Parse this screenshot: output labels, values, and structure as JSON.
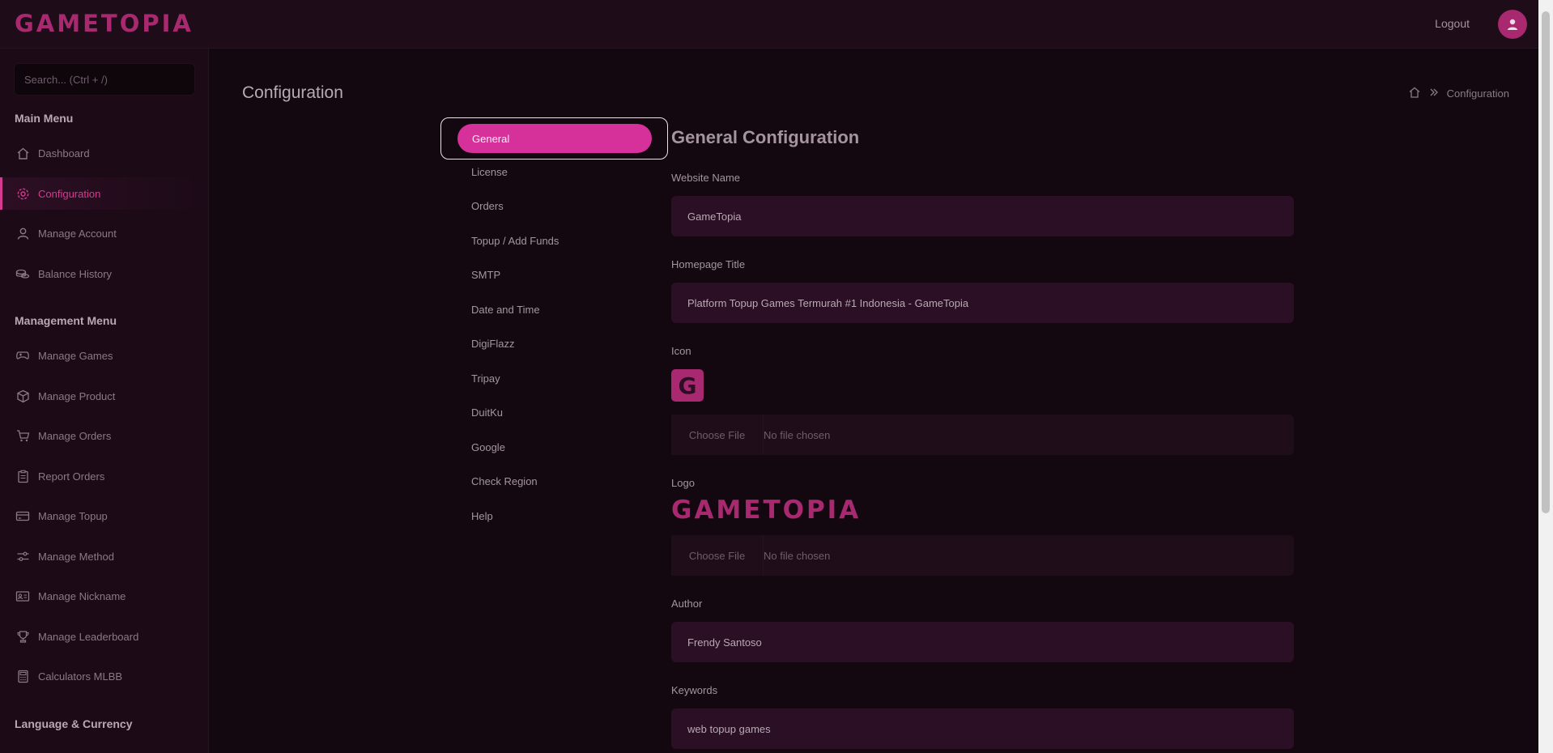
{
  "header": {
    "brand": "GAMETOPIA",
    "logout_label": "Logout",
    "avatar_icon": "user-icon"
  },
  "sidebar": {
    "search_placeholder": "Search... (Ctrl + /)",
    "main_menu_title": "Main Menu",
    "main_items": [
      {
        "label": "Dashboard",
        "icon": "home-icon"
      },
      {
        "label": "Configuration",
        "icon": "gear-icon",
        "active": true
      },
      {
        "label": "Manage Account",
        "icon": "user-icon"
      },
      {
        "label": "Balance History",
        "icon": "coins-icon"
      }
    ],
    "management_menu_title": "Management Menu",
    "management_items": [
      {
        "label": "Manage Games",
        "icon": "gamepad-icon"
      },
      {
        "label": "Manage Product",
        "icon": "box-icon"
      },
      {
        "label": "Manage Orders",
        "icon": "cart-icon"
      },
      {
        "label": "Report Orders",
        "icon": "clipboard-icon"
      },
      {
        "label": "Manage Topup",
        "icon": "card-icon"
      },
      {
        "label": "Manage Method",
        "icon": "sliders-icon"
      },
      {
        "label": "Manage Nickname",
        "icon": "id-card-icon"
      },
      {
        "label": "Manage Leaderboard",
        "icon": "trophy-icon"
      },
      {
        "label": "Calculators MLBB",
        "icon": "calculator-icon"
      }
    ],
    "language_title": "Language & Currency"
  },
  "page": {
    "title": "Configuration",
    "breadcrumb_current": "Configuration"
  },
  "subnav": {
    "active": "General",
    "items": [
      "License",
      "Orders",
      "Topup / Add Funds",
      "SMTP",
      "Date and Time",
      "DigiFlazz",
      "Tripay",
      "DuitKu",
      "Google",
      "Check Region",
      "Help"
    ]
  },
  "form": {
    "section_title": "General Configuration",
    "website_name_label": "Website Name",
    "website_name_value": "GameTopia",
    "homepage_title_label": "Homepage Title",
    "homepage_title_value": "Platform Topup Games Termurah #1 Indonesia - GameTopia",
    "icon_label": "Icon",
    "icon_letter": "G",
    "choose_file_label": "Choose File",
    "no_file_label": "No file chosen",
    "logo_label": "Logo",
    "logo_text": "GAMETOPIA",
    "author_label": "Author",
    "author_value": "Frendy Santoso",
    "keywords_label": "Keywords",
    "keywords_value": "web topup games"
  },
  "colors": {
    "accent": "#d6319a",
    "brand": "#a8296f",
    "background": "#140810"
  }
}
